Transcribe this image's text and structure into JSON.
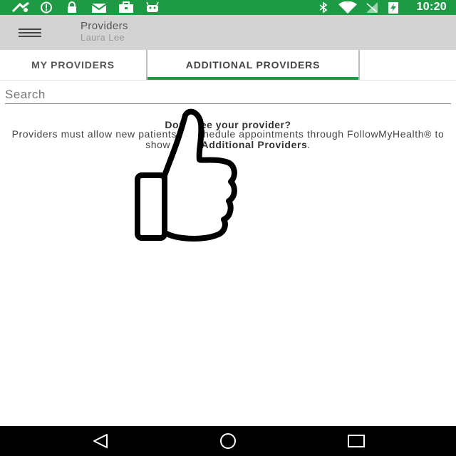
{
  "status_bar": {
    "time": "10:20",
    "icons": [
      "app-icon",
      "info-icon",
      "lock-icon",
      "mail-icon",
      "briefcase-icon",
      "android-icon",
      "bluetooth-icon",
      "wifi-icon",
      "no-signal-icon",
      "battery-charging-icon"
    ],
    "color": "#1f9a44"
  },
  "app_bar": {
    "title": "Providers",
    "subtitle": "Laura Lee",
    "background": "#d3d3d3"
  },
  "tabs": [
    {
      "label": "MY PROVIDERS",
      "selected": false
    },
    {
      "label": "ADDITIONAL PROVIDERS",
      "selected": true
    }
  ],
  "search": {
    "placeholder": "Search",
    "value": ""
  },
  "info": {
    "heading": "Don't see your provider?",
    "body_prefix": "Providers must allow new patients to schedule appointments through FollowMyHealth® to show under",
    "body_emphasis": "Additional Providers",
    "body_suffix": "."
  },
  "overlay": {
    "icon": "thumbs-up-icon"
  },
  "nav_bar": {
    "buttons": [
      "back-icon",
      "home-icon",
      "recents-icon"
    ]
  }
}
